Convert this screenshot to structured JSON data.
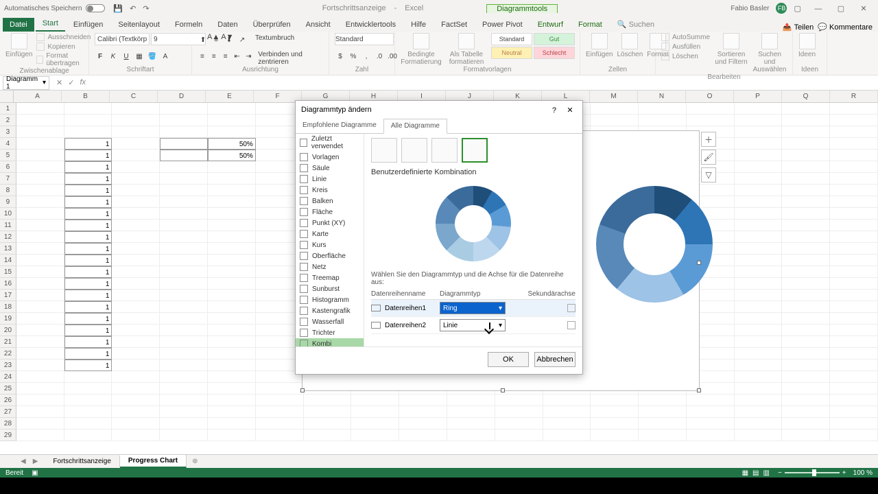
{
  "titlebar": {
    "autosave_label": "Automatisches Speichern",
    "doc_name": "Fortschrittsanzeige",
    "app_name": "Excel",
    "context_tools": "Diagrammtools",
    "user_name": "Fabio Basler",
    "user_initials": "FB"
  },
  "ribbon_tabs": {
    "file": "Datei",
    "start": "Start",
    "einfuegen": "Einfügen",
    "seitenlayout": "Seitenlayout",
    "formeln": "Formeln",
    "daten": "Daten",
    "ueberpruefen": "Überprüfen",
    "ansicht": "Ansicht",
    "entwickler": "Entwicklertools",
    "hilfe": "Hilfe",
    "factset": "FactSet",
    "powerpivot": "Power Pivot",
    "entwurf": "Entwurf",
    "format": "Format",
    "suchen": "Suchen",
    "teilen": "Teilen",
    "kommentare": "Kommentare"
  },
  "ribbon": {
    "clipboard": {
      "paste": "Einfügen",
      "cut": "Ausschneiden",
      "copy": "Kopieren",
      "formatpainter": "Format übertragen",
      "group": "Zwischenablage"
    },
    "font": {
      "name": "Calibri (Textkörper)",
      "size": "9",
      "group": "Schriftart"
    },
    "alignment": {
      "wrap": "Textumbruch",
      "merge": "Verbinden und zentrieren",
      "group": "Ausrichtung"
    },
    "number": {
      "format": "Standard",
      "group": "Zahl"
    },
    "condfmt": {
      "cond": "Bedingte Formatierung",
      "table": "Als Tabelle formatieren",
      "group": "Formatvorlagen"
    },
    "styles": {
      "standard": "Standard",
      "gut": "Gut",
      "neutral": "Neutral",
      "schlecht": "Schlecht"
    },
    "cells": {
      "insert": "Einfügen",
      "delete": "Löschen",
      "format": "Format",
      "group": "Zellen"
    },
    "editing": {
      "autosum": "AutoSumme",
      "fill": "Ausfüllen",
      "clear": "Löschen",
      "sort": "Sortieren und Filtern",
      "find": "Suchen und Auswählen",
      "group": "Bearbeiten"
    },
    "ideas": {
      "ideen": "Ideen",
      "group": "Ideen"
    }
  },
  "namebox": "Diagramm 1",
  "columns": [
    "A",
    "B",
    "C",
    "D",
    "E",
    "F",
    "G",
    "H",
    "I",
    "J",
    "K",
    "L",
    "M",
    "N",
    "O",
    "P",
    "Q",
    "R"
  ],
  "data_col_b": [
    "1",
    "1",
    "1",
    "1",
    "1",
    "1",
    "1",
    "1",
    "1",
    "1",
    "1",
    "1",
    "1",
    "1",
    "1",
    "1",
    "1",
    "1",
    "1",
    "1"
  ],
  "data_e": {
    "r4": "50%",
    "r5": "50%"
  },
  "dialog": {
    "title": "Diagrammtyp ändern",
    "tab_rec": "Empfohlene Diagramme",
    "tab_all": "Alle Diagramme",
    "cats": [
      "Zuletzt verwendet",
      "Vorlagen",
      "Säule",
      "Linie",
      "Kreis",
      "Balken",
      "Fläche",
      "Punkt (XY)",
      "Karte",
      "Kurs",
      "Oberfläche",
      "Netz",
      "Treemap",
      "Sunburst",
      "Histogramm",
      "Kastengrafik",
      "Wasserfall",
      "Trichter",
      "Kombi"
    ],
    "subtitle": "Benutzerdefinierte Kombination",
    "hint": "Wählen Sie den Diagrammtyp und die Achse für die Datenreihe aus:",
    "hdr_name": "Datenreihenname",
    "hdr_type": "Diagrammtyp",
    "hdr_sec": "Sekundärachse",
    "series1": "Datenreihen1",
    "series2": "Datenreihen2",
    "combo_ring": "Ring",
    "combo_line": "Linie",
    "ok": "OK",
    "cancel": "Abbrechen"
  },
  "sheets": {
    "s1": "Fortschrittsanzeige",
    "s2": "Progress Chart"
  },
  "status": {
    "ready": "Bereit",
    "zoom": "100 %"
  }
}
